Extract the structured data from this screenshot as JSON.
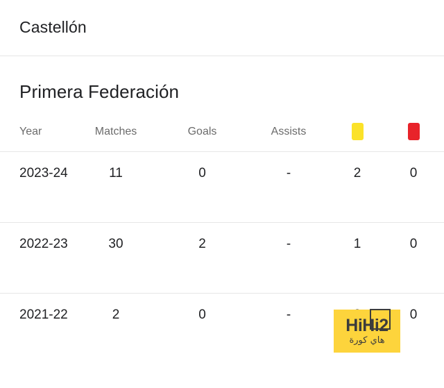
{
  "club": {
    "name": "Castellón"
  },
  "competition": {
    "title": "Primera Federación"
  },
  "table": {
    "columns": [
      {
        "key": "year",
        "label": "Year",
        "type": "text"
      },
      {
        "key": "matches",
        "label": "Matches",
        "type": "text"
      },
      {
        "key": "goals",
        "label": "Goals",
        "type": "text"
      },
      {
        "key": "assists",
        "label": "Assists",
        "type": "text"
      },
      {
        "key": "yellow",
        "label": "",
        "type": "icon",
        "icon": "yellow-card-icon",
        "color": "#fbe229"
      },
      {
        "key": "red",
        "label": "",
        "type": "icon",
        "icon": "red-card-icon",
        "color": "#e8232a"
      }
    ],
    "rows": [
      {
        "year": "2023-24",
        "matches": "11",
        "goals": "0",
        "assists": "-",
        "yellow": "2",
        "red": "0"
      },
      {
        "year": "2022-23",
        "matches": "30",
        "goals": "2",
        "assists": "-",
        "yellow": "1",
        "red": "0"
      },
      {
        "year": "2021-22",
        "matches": "2",
        "goals": "0",
        "assists": "-",
        "yellow": "0",
        "red": "0"
      }
    ]
  },
  "watermark": {
    "brand": "HiHi2",
    "brand_prefix": "HiHi",
    "brand_digit": "2",
    "subtitle": "هاي كورة",
    "background": "#fdd43c",
    "text_color": "#3c3c3c"
  }
}
